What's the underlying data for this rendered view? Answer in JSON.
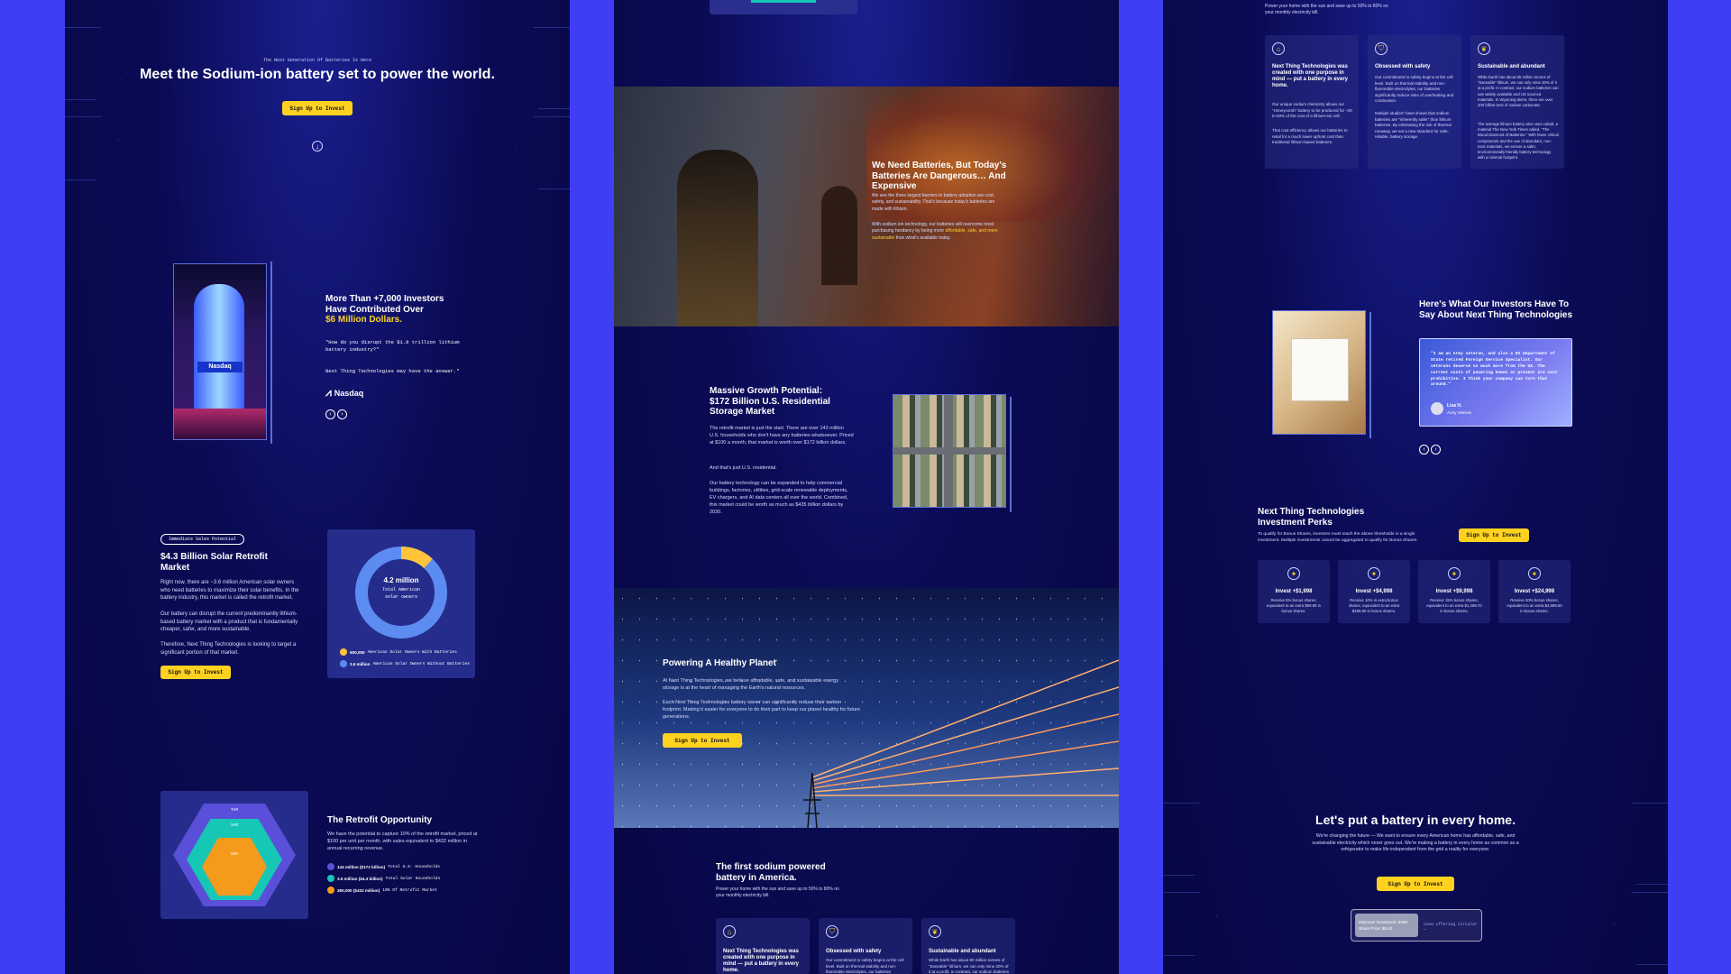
{
  "hero": {
    "eyebrow": "The Next Generation Of Batteries Is Here",
    "title": "Meet the Sodium-ion battery set to power the world.",
    "cta": "Sign Up to Invest"
  },
  "investors": {
    "title": "More Than +7,000 Investors Have Contributed Over",
    "amount": "$6 Million Dollars.",
    "quote1": "\"How do you disrupt the $1.8 trillion lithium battery industry?\"",
    "quote2": "Next Thing Technologies may have the answer.\"",
    "brand": "Nasdaq",
    "billboard": "Nasdaq"
  },
  "solar": {
    "tag": "Immediate Sales Potential",
    "title": "$4.3 Billion Solar Retrofit Market",
    "p1": "Right now, there are ~3.6 million American solar owners who need batteries to maximize their solar benefits. In the battery industry, this market is called the retrofit market.",
    "p2": "Our battery can disrupt the current predominantly lithium-based battery market with a product that is fundamentally cheaper, safer, and more sustainable.",
    "p3": "Therefore, Next Thing Technologies is looking to target a significant portion of that market.",
    "cta": "Sign Up to Invest",
    "donut_value": "4.2 million",
    "donut_label": "Total American solar owners",
    "leg1_v": "500,000",
    "leg1_t": "American Solar Owners With Batteries",
    "leg2_v": "3.6 million",
    "leg2_t": "American Solar Owners Without Batteries"
  },
  "retrofit": {
    "title": "The Retrofit Opportunity",
    "p": "We have the potential to capture 10% of the retrofit market, priced at $100 per unit per month, with sales equivalent to $432 million in annual recurring revenue.",
    "hex1": "TAM",
    "hex2": "SAM",
    "hex3": "SOM",
    "l1_v": "144 million ($172 billion)",
    "l1_t": "Total U.S. Households",
    "l2_v": "3.6 million ($4.3 billion)",
    "l2_t": "Total Solar Households",
    "l3_v": "360,000 ($432 million)",
    "l3_t": "10% Of Retrofit Market"
  },
  "danger": {
    "title": "We Need Batteries, But Today's Batteries Are Dangerous… And Expensive",
    "p1": "We see the three largest barriers to battery adoption are cost, safety, and sustainability. That's because today's batteries are made with lithium.",
    "p2a": "With sodium ion technology, our batteries will overcome most purchasing hesitancy by being more",
    "p2b": "affordable, safe, and more sustainable",
    "p2c": "than what's available today."
  },
  "growth": {
    "title": "Massive Growth Potential: $172 Billion U.S. Residential Storage Market",
    "p1": "The retrofit market is just the start. There are over 143 million U.S. households who don't have any batteries whatsoever. Priced at $100 a month, that market is worth over $172 billion dollars.",
    "p2": "And that's just U.S. residential.",
    "p3": "Our battery technology can be expanded to help commercial buildings, factories, utilities, grid-scale renewable deployments, EV chargers, and AI data centers all over the world. Combined, this market could be worth as much as $435 billion dollars by 2030."
  },
  "planet": {
    "title": "Powering A Healthy Planet",
    "p1": "At Next Thing Technologies, we believe affordable, safe, and sustainable energy storage is at the heart of managing the Earth's natural resources.",
    "p2": "Each Next Thing Technologies battery owner can significantly reduce their carbon footprint. Making it easier for everyone to do their part to keep our planet healthy for future generations.",
    "cta": "Sign Up to Invest"
  },
  "first": {
    "title": "The first sodium powered battery in America.",
    "p": "Power your home with the sun and save up to 50% to 80% on your monthly electricity bill."
  },
  "features": [
    {
      "title": "Next Thing Technologies was created with one purpose in mind — put a battery in every home.",
      "p1": "Our unique sodium chemistry allows our \"Honeycomb\" battery to be produced for ~30 to 60% of the cost of a lithium-ion cell.",
      "p2": "That cost efficiency allows our batteries to retail for a much lower upfront cost than traditional lithium-based batteries."
    },
    {
      "title": "Obsessed with safety",
      "p1": "Our commitment to safety begins at the cell level. Built on thermal stability and non-flammable electrolytes, our batteries significantly reduce risks of overheating and combustion.",
      "p2": "Multiple studies* have shown that sodium batteries are \"inherently safer\" than lithium batteries. By eliminating the risk of thermal runaway, we set a new standard for safe, reliable, battery storage."
    },
    {
      "title": "Sustainable and abundant",
      "p1": "While Earth has about 80 million tonnes of \"traceable\" lithium, we can only mine 20% of it at a profit. In contrast, our sodium batteries can use widely available and US sourced materials. In Wyoming alone, there are over 200 billion tons of sodium carbonate.",
      "p2": "The average lithium battery also uses cobalt, a material The New York Times called, \"The Blood Diamond of Batteries.\" With fewer critical components and the use of abundant, non-toxic materials, we ensure a safer, environmentally friendly battery technology with a minimal footprint."
    }
  ],
  "testimonials": {
    "title": "Here's What Our Investors Have To Say About Next Thing Technologies",
    "quote": "\"I am an Army veteran, and also a US Department of State retired Foreign Service Specialist. Our veterans deserve so much more from the US. The current costs of powering homes at present are cost prohibitive. I think your company can turn that around.\"",
    "name": "Lisa H.",
    "role": "Army Veteran"
  },
  "perks": {
    "title": "Next Thing Technologies Investment Perks",
    "p": "To qualify for Bonus Shares, investors must reach the above thresholds in a single investment. Multiple investments cannot be aggregated to qualify for Bonus Shares.",
    "cta": "Sign Up to Invest",
    "tiers": [
      {
        "t": "Invest +$1,998",
        "d": "Receive 5% bonus shares, equivalent to an extra $99.90 in bonus shares."
      },
      {
        "t": "Invest +$4,998",
        "d": "Receive 10% in extra bonus shares, equivalent to an extra $499.80 in bonus shares."
      },
      {
        "t": "Invest +$9,998",
        "d": "Receive 15% bonus shares, equivalent to an extra $1,499.70 in bonus shares."
      },
      {
        "t": "Invest +$24,998",
        "d": "Receive 20% bonus shares, equivalent to an extra $4,999.60 in bonus shares."
      }
    ]
  },
  "final": {
    "title": "Let's put a battery in every home.",
    "p": "We're changing the future — We want to ensure every American home has affordable, safe, and sustainable electricity which never goes out. We're making a battery in every home as common as a refrigerator to make life independent from the grid a reality for everyone.",
    "cta": "Sign Up to Invest",
    "min": "Minimum Investment: $498",
    "price": "Share Price: $8.60",
    "link": "View offering circular →"
  },
  "colors": {
    "accent": "#ffd21f",
    "bg": "#3f3ef5",
    "panel": "#0a0b55",
    "teal": "#17c7b6",
    "orange": "#f49a1c"
  }
}
